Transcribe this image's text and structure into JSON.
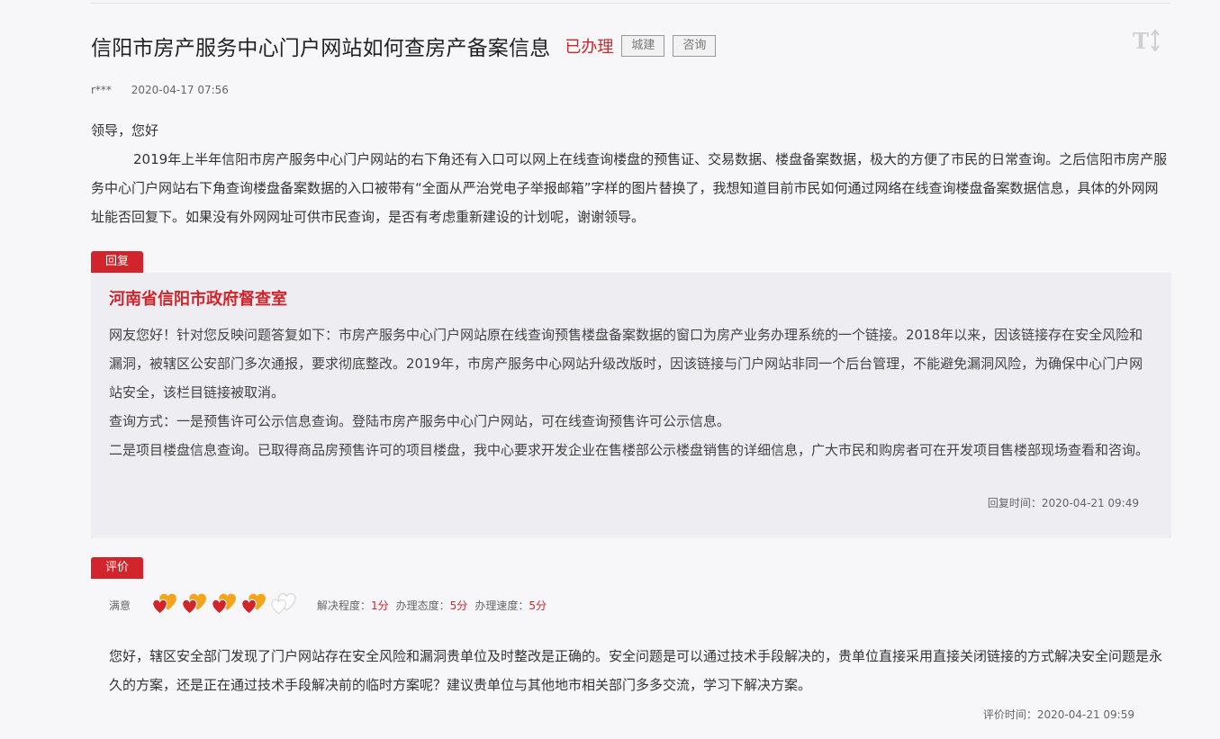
{
  "title": "信阳市房产服务中心门户网站如何查房产备案信息",
  "status": "已办理",
  "tags": [
    "城建",
    "咨询"
  ],
  "author": "r***",
  "date": "2020-04-17 07:56",
  "question": {
    "greeting": "领导，您好",
    "body": "2019年上半年信阳市房产服务中心门户网站的右下角还有入口可以网上在线查询楼盘的预售证、交易数据、楼盘备案数据，极大的方便了市民的日常查询。之后信阳市房产服务中心门户网站右下角查询楼盘备案数据的入口被带有“全面从严治党电子举报邮箱”字样的图片替换了，我想知道目前市民如何通过网络在线查询楼盘备案数据信息，具体的外网网址能否回复下。如果没有外网网址可供市民查询，是否有考虑重新建设的计划呢，谢谢领导。"
  },
  "reply": {
    "badge": "回复",
    "org": "河南省信阳市政府督查室",
    "paragraphs": [
      "网友您好！针对您反映问题答复如下：市房产服务中心门户网站原在线查询预售楼盘备案数据的窗口为房产业务办理系统的一个链接。2018年以来，因该链接存在安全风险和漏洞，被辖区公安部门多次通报，要求彻底整改。2019年，市房产服务中心网站升级改版时，因该链接与门户网站非同一个后台管理，不能避免漏洞风险，为确保中心门户网站安全，该栏目链接被取消。",
      "查询方式：一是预售许可公示信息查询。登陆市房产服务中心门户网站，可在线查询预售许可公示信息。",
      "二是项目楼盘信息查询。已取得商品房预售许可的项目楼盘，我中心要求开发企业在售楼部公示楼盘销售的详细信息，广大市民和购房者可在开发项目售楼部现场查看和咨询。"
    ],
    "time": "回复时间：2020-04-21 09:49"
  },
  "evaluation": {
    "badge": "评价",
    "satisfaction": "满意",
    "hearts_total": 5,
    "hearts_filled": 4,
    "colors": {
      "accent": "#d1242b",
      "heart_gold": "#f3a51c",
      "heart_red": "#d1242b",
      "heart_empty": "#d9d9d9"
    },
    "scores": [
      {
        "label": "解决程度：",
        "value": "1分"
      },
      {
        "label": "办理态度：",
        "value": "5分"
      },
      {
        "label": "办理速度：",
        "value": "5分"
      }
    ],
    "text": "您好，辖区安全部门发现了门户网站存在安全风险和漏洞贵单位及时整改是正确的。安全问题是可以通过技术手段解决的，贵单位直接采用直接关闭链接的方式解决安全问题是永久的方案，还是正在通过技术手段解决前的临时方案呢？建议贵单位与其他地市相关部门多多交流，学习下解决方案。",
    "time": "评价时间：2020-04-21 09:59"
  },
  "icons": {
    "font_size_toggle": "font-size-toggle-icon",
    "heart": "heart-icon"
  }
}
